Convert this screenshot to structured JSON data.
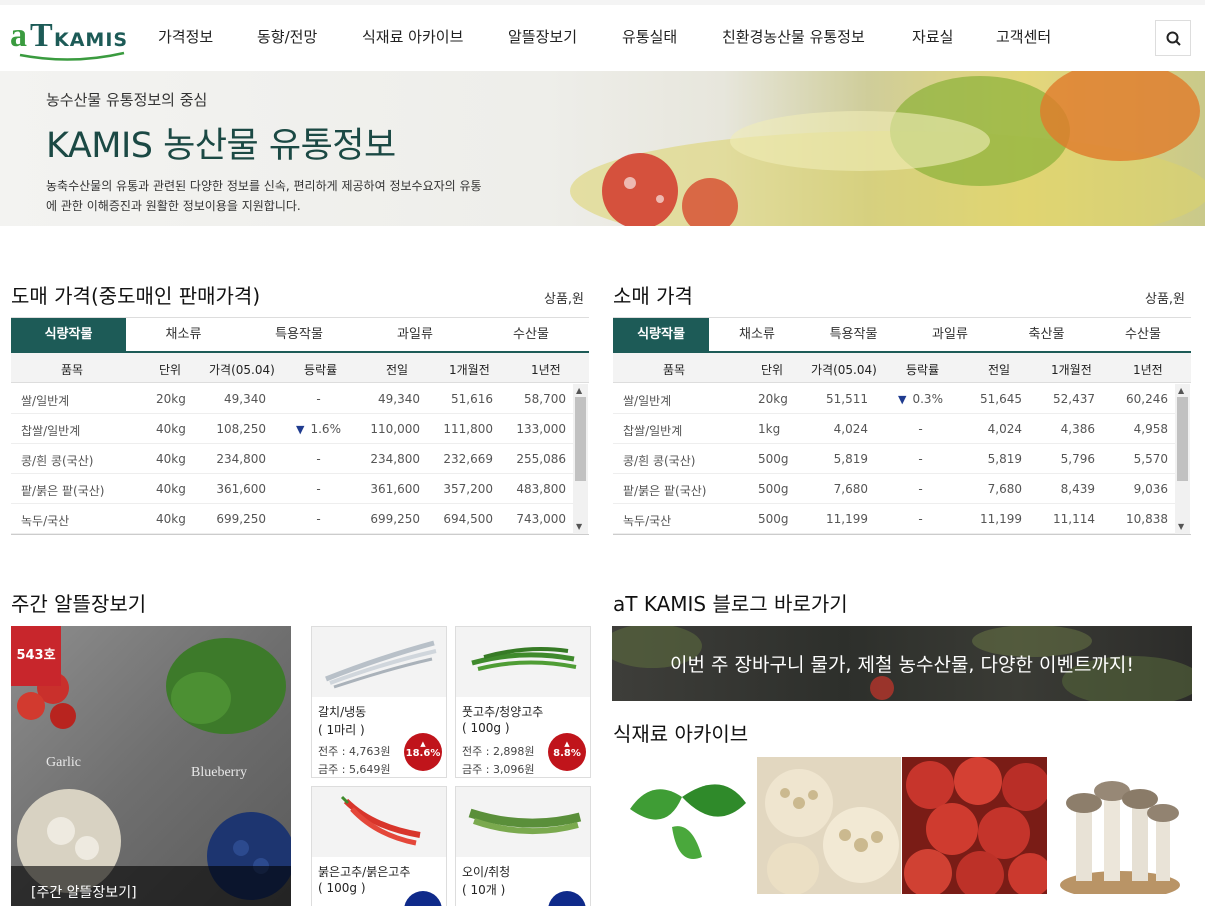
{
  "brand": {
    "logo_a": "a",
    "logo_t": "T",
    "logo_k": "KAMIS"
  },
  "nav": [
    "가격정보",
    "동향/전망",
    "식재료 아카이브",
    "알뜰장보기",
    "유통실태",
    "친환경농산물 유통정보",
    "자료실",
    "고객센터"
  ],
  "hero": {
    "subtitle": "농수산물 유통정보의 중심",
    "title": "KAMIS 농산물 유통정보",
    "desc": "농축수산물의 유통과 관련된 다양한 정보를 신속, 편리하게 제공하여 정보수요자의 유통에 관한 이해증진과 원활한 정보이용을 지원합니다."
  },
  "wholesale": {
    "title": "도매 가격(중도매인 판매가격)",
    "unit_note": "상품,원",
    "tabs": [
      "식량작물",
      "채소류",
      "특용작물",
      "과일류",
      "수산물"
    ],
    "columns": [
      "품목",
      "단위",
      "가격(05.04)",
      "등락률",
      "전일",
      "1개월전",
      "1년전"
    ],
    "rows": [
      {
        "item": "쌀/일반계",
        "unit": "20kg",
        "price": "49,340",
        "change": "-",
        "prev_day": "49,340",
        "month_ago": "51,616",
        "year_ago": "58,700"
      },
      {
        "item": "찹쌀/일반계",
        "unit": "40kg",
        "price": "108,250",
        "change": "1.6%",
        "prev_day": "110,000",
        "month_ago": "111,800",
        "year_ago": "133,000"
      },
      {
        "item": "콩/흰 콩(국산)",
        "unit": "40kg",
        "price": "234,800",
        "change": "-",
        "prev_day": "234,800",
        "month_ago": "232,669",
        "year_ago": "255,086"
      },
      {
        "item": "팥/붉은 팥(국산)",
        "unit": "40kg",
        "price": "361,600",
        "change": "-",
        "prev_day": "361,600",
        "month_ago": "357,200",
        "year_ago": "483,800"
      },
      {
        "item": "녹두/국산",
        "unit": "40kg",
        "price": "699,250",
        "change": "-",
        "prev_day": "699,250",
        "month_ago": "694,500",
        "year_ago": "743,000"
      }
    ]
  },
  "retail": {
    "title": "소매 가격",
    "unit_note": "상품,원",
    "tabs": [
      "식량작물",
      "채소류",
      "특용작물",
      "과일류",
      "축산물",
      "수산물"
    ],
    "columns": [
      "품목",
      "단위",
      "가격(05.04)",
      "등락률",
      "전일",
      "1개월전",
      "1년전"
    ],
    "rows": [
      {
        "item": "쌀/일반계",
        "unit": "20kg",
        "price": "51,511",
        "change": "0.3%",
        "prev_day": "51,645",
        "month_ago": "52,437",
        "year_ago": "60,246"
      },
      {
        "item": "찹쌀/일반계",
        "unit": "1kg",
        "price": "4,024",
        "change": "-",
        "prev_day": "4,024",
        "month_ago": "4,386",
        "year_ago": "4,958"
      },
      {
        "item": "콩/흰 콩(국산)",
        "unit": "500g",
        "price": "5,819",
        "change": "-",
        "prev_day": "5,819",
        "month_ago": "5,796",
        "year_ago": "5,570"
      },
      {
        "item": "팥/붉은 팥(국산)",
        "unit": "500g",
        "price": "7,680",
        "change": "-",
        "prev_day": "7,680",
        "month_ago": "8,439",
        "year_ago": "9,036"
      },
      {
        "item": "녹두/국산",
        "unit": "500g",
        "price": "11,199",
        "change": "-",
        "prev_day": "11,199",
        "month_ago": "11,114",
        "year_ago": "10,838"
      }
    ]
  },
  "weekly": {
    "title": "주간 알뜰장보기",
    "issue": "543호",
    "caption": "[주간 알뜰장보기]",
    "cards": [
      {
        "name": "갈치/냉동",
        "unit": "( 1마리 )",
        "prev": "전주 : 4,763원",
        "curr": "금주 : 5,649원",
        "pct": "18.6%"
      },
      {
        "name": "풋고추/청양고추",
        "unit": "( 100g )",
        "prev": "전주 : 2,898원",
        "curr": "금주 : 3,096원",
        "pct": "8.8%"
      },
      {
        "name": "붉은고추/붉은고추",
        "unit": "( 100g )",
        "prev": "",
        "curr": "",
        "pct": ""
      },
      {
        "name": "오이/취청",
        "unit": "( 10개 )",
        "prev": "",
        "curr": "",
        "pct": ""
      }
    ],
    "up_color": "#c0141b",
    "down_color": "#0f2a8a"
  },
  "blog": {
    "title": "aT KAMIS 블로그 바로가기",
    "banner_text": "이번 주 장바구니 물가, 제철 농수산물, 다양한 이벤트까지!"
  },
  "archive": {
    "title": "식재료 아카이브"
  },
  "colors": {
    "brand_green": "#1d5b57",
    "accent_red": "#c8262c"
  }
}
